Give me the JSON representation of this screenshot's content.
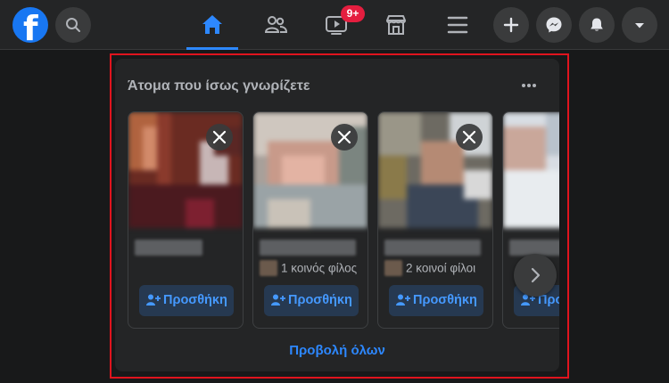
{
  "topbar": {
    "logo_letter": "f",
    "notification_badge": "9+",
    "tabs": [
      "home",
      "friends",
      "watch",
      "marketplace",
      "menu"
    ],
    "actions": [
      "create",
      "messenger",
      "notifications",
      "account"
    ]
  },
  "panel": {
    "title": "Άτομα που ίσως γνωρίζετε",
    "see_all_label": "Προβολή όλων",
    "cards": [
      {
        "mutual_friends": "",
        "add_label": "Προσθήκη"
      },
      {
        "mutual_friends": "1 κοινός φίλος",
        "add_label": "Προσθήκη"
      },
      {
        "mutual_friends": "2 κοινοί φίλοι",
        "add_label": "Προσθήκη"
      },
      {
        "mutual_friends": "",
        "add_label": "Προσθήκη"
      }
    ]
  },
  "colors": {
    "accent": "#2d88ff",
    "brand": "#1877f2",
    "highlight_outline": "#e0141e",
    "badge": "#e41e3f"
  }
}
